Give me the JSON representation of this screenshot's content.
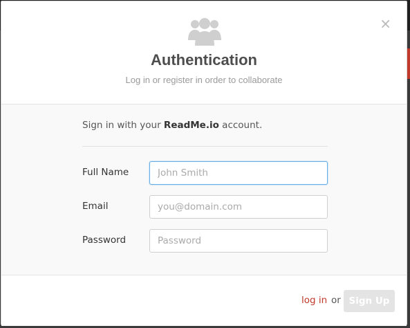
{
  "modal": {
    "close_glyph": "×",
    "header_icon": "users-icon",
    "title": "Authentication",
    "subtitle": "Log in or register in order to collaborate"
  },
  "body": {
    "intro_prefix": "Sign in with your ",
    "intro_brand": "ReadMe.io",
    "intro_suffix": " account.",
    "fields": [
      {
        "label": "Full Name",
        "placeholder": "John Smith",
        "value": ""
      },
      {
        "label": "Email",
        "placeholder": "you@domain.com",
        "value": ""
      },
      {
        "label": "Password",
        "placeholder": "Password",
        "value": ""
      }
    ]
  },
  "footer": {
    "login_label": "log in",
    "or_label": "or",
    "signup_label": "Sign Up"
  },
  "colors": {
    "accent_red": "#c0392b",
    "focus_blue": "#66afe9",
    "icon_gray": "#cfcfcf",
    "title_gray": "#4d4d4d"
  }
}
